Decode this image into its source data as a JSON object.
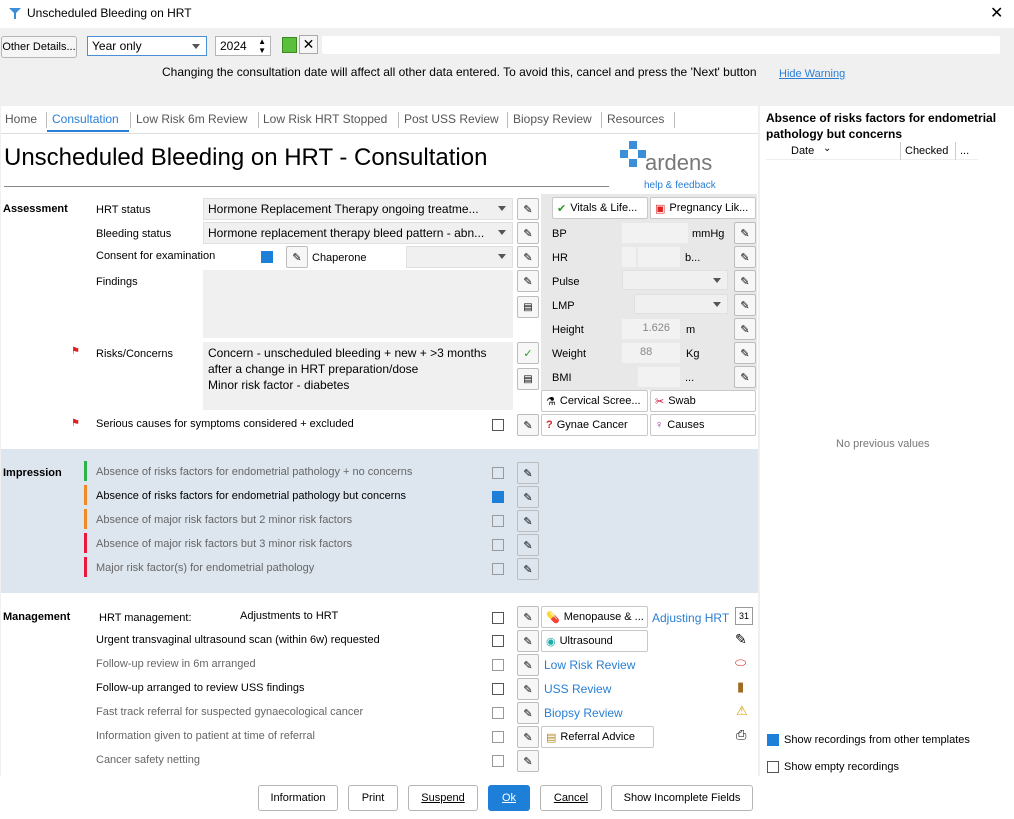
{
  "window": {
    "title": "Unscheduled Bleeding on HRT"
  },
  "toolbar": {
    "other_details": "Other Details...",
    "period": "Year only",
    "year": "2024",
    "warning": "Changing the consultation date will affect all other data entered. To avoid this, cancel and press the 'Next' button",
    "hide_warning": "Hide Warning"
  },
  "tabs": [
    "Home",
    "Consultation",
    "Low Risk 6m Review",
    "Low Risk HRT Stopped",
    "Post USS Review",
    "Biopsy Review",
    "Resources"
  ],
  "page": {
    "title": "Unscheduled Bleeding on HRT - Consultation"
  },
  "brand": {
    "name": "ardens",
    "help": "help & feedback"
  },
  "assessment": {
    "heading": "Assessment",
    "hrt_status_label": "HRT status",
    "hrt_status_value": "Hormone Replacement Therapy ongoing treatme...",
    "bleeding_label": "Bleeding status",
    "bleeding_value": "Hormone replacement therapy bleed pattern - abn...",
    "consent_label": "Consent for examination",
    "chaperone_label": "Chaperone",
    "findings_label": "Findings",
    "risks_label": "Risks/Concerns",
    "risks_line1": "Concern - unscheduled bleeding + new + >3 months",
    "risks_line2": "after a change in HRT preparation/dose",
    "risks_line3": "Minor risk factor - diabetes",
    "serious_label": "Serious causes for symptoms considered + excluded"
  },
  "vitals": {
    "vitals_btn": "Vitals & Life...",
    "pregnancy_btn": "Pregnancy Lik...",
    "bp": "BP",
    "bp_unit": "mmHg",
    "hr": "HR",
    "hr_unit": "b...",
    "pulse": "Pulse",
    "lmp": "LMP",
    "height": "Height",
    "height_value": "1.626",
    "height_unit": "m",
    "weight": "Weight",
    "weight_value": "88",
    "weight_unit": "Kg",
    "bmi": "BMI",
    "bmi_unit": "...",
    "cervical": "Cervical Scree...",
    "swab": "Swab",
    "gynae": "Gynae Cancer",
    "causes": "Causes"
  },
  "impression": {
    "heading": "Impression",
    "items": [
      {
        "label": "Absence of risks factors for endometrial pathology + no concerns",
        "color": "#2db34a"
      },
      {
        "label": "Absence of risks factors for endometrial pathology but concerns",
        "color": "#f08a24"
      },
      {
        "label": "Absence of major risk factors but 2 minor risk factors",
        "color": "#f08a24"
      },
      {
        "label": "Absence of major risk factors but 3 minor risk factors",
        "color": "#e8193c"
      },
      {
        "label": "Major risk factor(s) for endometrial pathology",
        "color": "#e8193c"
      }
    ]
  },
  "management": {
    "heading": "Management",
    "hrt_label": "HRT management:",
    "hrt_value": "Adjustments to HRT",
    "menopause_btn": "Menopause & ...",
    "adjusting_link": "Adjusting HRT",
    "uss_label": "Urgent transvaginal ultrasound scan (within 6w) requested",
    "ultrasound_btn": "Ultrasound",
    "followup6m": "Follow-up review in 6m arranged",
    "low_risk_link": "Low Risk Review",
    "followup_uss": "Follow-up arranged to review USS findings",
    "uss_review_link": "USS Review",
    "fast_track": "Fast track referral for suspected gynaecological cancer",
    "biopsy_link": "Biopsy Review",
    "info_given": "Information given to patient at time of referral",
    "referral_btn": "Referral Advice",
    "safety_net": "Cancer safety netting"
  },
  "right_panel": {
    "title": "Absence of risks factors for endometrial pathology but concerns",
    "col_date": "Date",
    "col_checked": "Checked",
    "col_more": "...",
    "empty": "No previous values",
    "show_other": "Show recordings from other templates",
    "show_empty": "Show empty recordings"
  },
  "footer": {
    "information": "Information",
    "print": "Print",
    "suspend": "Suspend",
    "ok": "Ok",
    "cancel": "Cancel",
    "incomplete": "Show Incomplete Fields"
  }
}
